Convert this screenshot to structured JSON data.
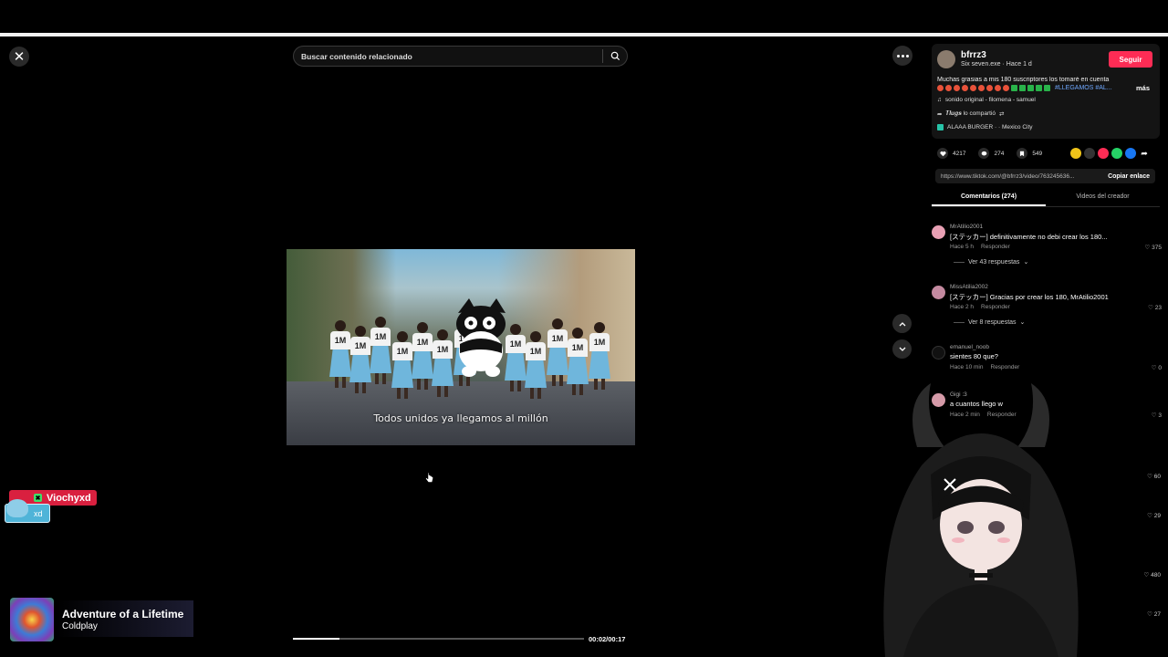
{
  "search": {
    "placeholder": "Buscar contenido relacionado"
  },
  "video": {
    "subtitle": "Todos unidos ya llegamos al millón",
    "shirt_text": "1M",
    "progress": 0.16,
    "time": "00:02/00:17"
  },
  "stream_overlay": {
    "chat_user": "Viochyxd",
    "chat_message": "xd",
    "now_playing": {
      "title": "Adventure of a Lifetime",
      "artist": "Coldplay"
    }
  },
  "author": {
    "name": "bfrrz3",
    "sub": "Six seven.exe · Hace 1 d",
    "follow_label": "Seguir",
    "description": "Muchas grasias a mis 180 suscriptores los tomaré en cuenta",
    "hashtag": "#LLEGAMOS #AL...",
    "more_label": "más",
    "sound": "sonido original - filomena - samuel",
    "shared_by": "𝑻𝒍𝒖𝒈𝒔 lo compartió",
    "location": "ALAAA BURGER · · Mexico City"
  },
  "actions": {
    "likes": "4217",
    "comments": "274",
    "saves": "549"
  },
  "link": {
    "url": "https://www.tiktok.com/@bfrrz3/video/763245636...",
    "copy_label": "Copiar enlace"
  },
  "tabs": [
    {
      "label": "Comentarios (274)"
    },
    {
      "label": "Videos del creador"
    }
  ],
  "comments": [
    {
      "user": "MrAtilio2001",
      "text": "[ステッカー] definitivamente no debi crear los 180...",
      "time": "Hace 5 h",
      "reply": "Responder",
      "likes": "375",
      "replies": "Ver 43 respuestas"
    },
    {
      "user": "MissAtilia2002",
      "text": "[ステッカー] Gracias por crear los 180, MrAtilio2001",
      "time": "Hace 2 h",
      "reply": "Responder",
      "likes": "23",
      "replies": "Ver 8 respuestas"
    },
    {
      "user": "emanuel_noob",
      "text": "sientes 80 que?",
      "time": "Hace 10 min",
      "reply": "Responder",
      "likes": "0"
    },
    {
      "user": "Gigi :3",
      "text": "a cuantos llego w",
      "time": "Hace 2 min",
      "reply": "Responder",
      "likes": "3"
    }
  ],
  "extra_likes": [
    "60",
    "29",
    "480",
    "27"
  ],
  "colors": {
    "accent": "#fe2c55",
    "chat_badge": "#d9203f"
  }
}
